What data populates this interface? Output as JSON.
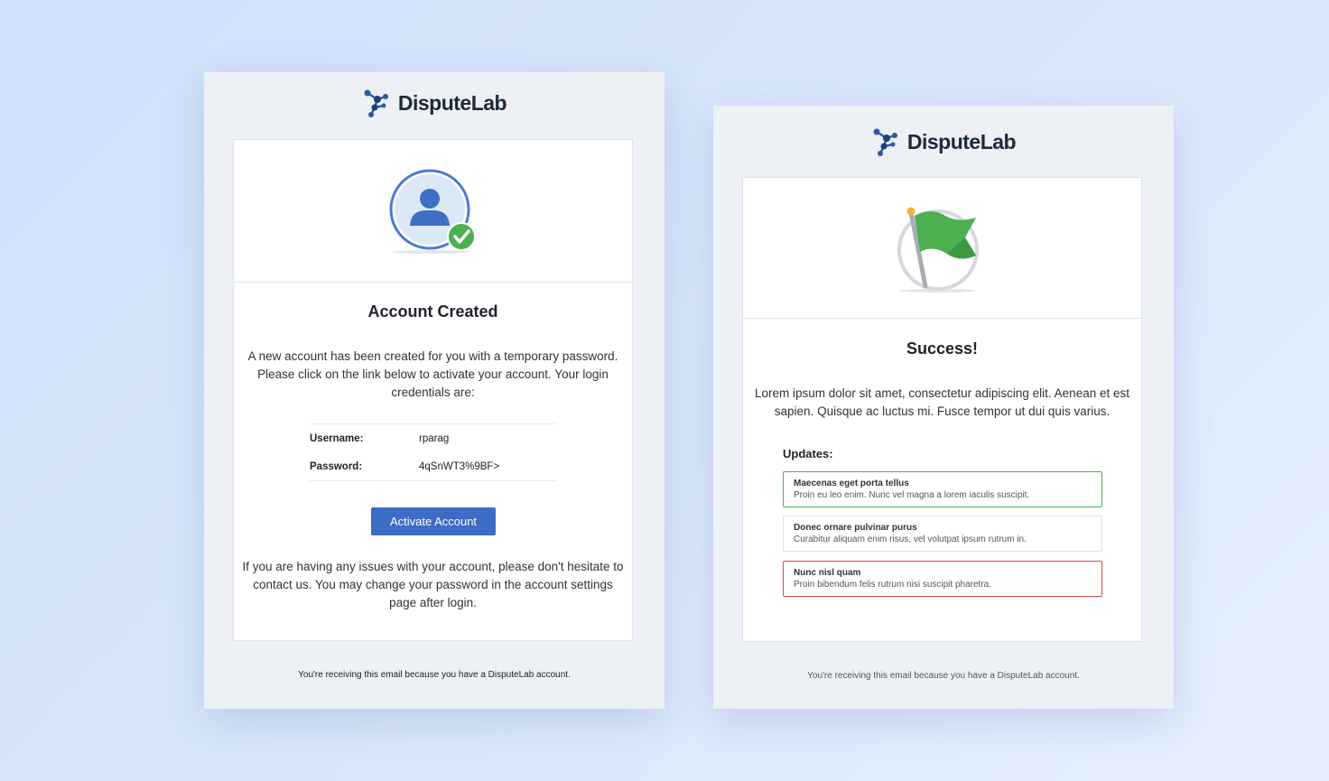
{
  "brand": {
    "name": "DisputeLab"
  },
  "colors": {
    "accent": "#3c6cc4",
    "success": "#4caf50",
    "danger": "#e04848",
    "neutral": "#dde0e5"
  },
  "account_email": {
    "hero_icon": "user-check-icon",
    "title": "Account Created",
    "intro_lines": [
      "A new account has been created for you with a temporary password.",
      "Please click on the link below to activate your account. Your login",
      "credentials are:"
    ],
    "credentials": [
      {
        "label": "Username:",
        "value": "rparag"
      },
      {
        "label": "Password:",
        "value": "4qSnWT3%9BF>"
      }
    ],
    "button_label": "Activate Account",
    "closing_lines": [
      "If you are having any issues with your account, please don't hesitate to",
      "contact us. You may change your password in the account settings",
      "page after login."
    ],
    "footer": "You're receiving this email because you have a DisputeLab account."
  },
  "success_email": {
    "hero_icon": "flag-icon",
    "title": "Success!",
    "intro_lines": [
      "Lorem ipsum dolor sit amet, consectetur adipiscing elit. Aenean et est",
      "sapien. Quisque ac luctus mi. Fusce tempor ut dui quis varius."
    ],
    "updates_label": "Updates:",
    "updates": [
      {
        "title": "Maecenas eget porta tellus",
        "description": "Proin eu leo enim. Nunc vel magna a lorem iaculis suscipit.",
        "status_color": "#4caf50"
      },
      {
        "title": "Donec ornare pulvinar purus",
        "description": "Curabitur aliquam enim risus, vel volutpat ipsum rutrum in.",
        "status_color": "#dde0e5"
      },
      {
        "title": "Nunc nisl quam",
        "description": "Proin bibendum felis rutrum nisi suscipit pharetra.",
        "status_color": "#e04848"
      }
    ],
    "footer": "You're receiving this email because you have a DisputeLab account."
  }
}
